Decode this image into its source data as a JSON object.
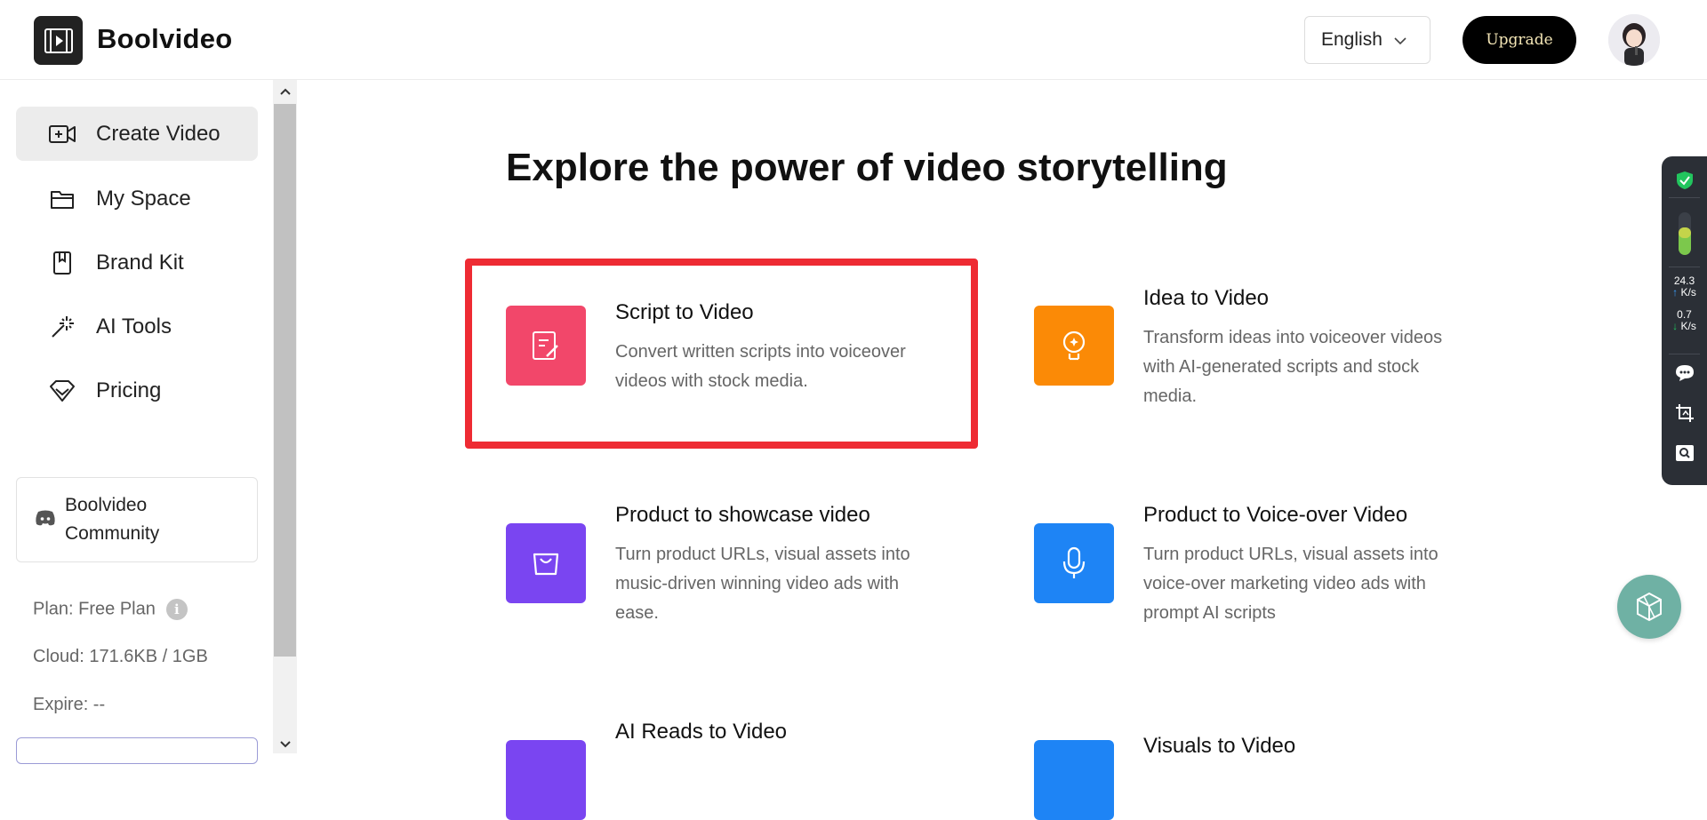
{
  "header": {
    "brand": "Boolvideo",
    "language": "English",
    "upgrade_label": "Upgrade"
  },
  "sidebar": {
    "items": [
      {
        "label": "Create Video",
        "icon": "video-plus-icon",
        "active": true
      },
      {
        "label": "My Space",
        "icon": "folder-icon",
        "active": false
      },
      {
        "label": "Brand Kit",
        "icon": "bookmark-icon",
        "active": false
      },
      {
        "label": "AI Tools",
        "icon": "magic-wand-icon",
        "active": false
      },
      {
        "label": "Pricing",
        "icon": "diamond-icon",
        "active": false
      }
    ],
    "community": {
      "line1": "Boolvideo",
      "line2": "Community"
    },
    "plan": "Plan: Free Plan",
    "cloud": "Cloud: 171.6KB / 1GB",
    "expire": "Expire: --"
  },
  "main": {
    "title": "Explore the power of video storytelling",
    "cards": [
      {
        "title": "Script to Video",
        "desc1": "Convert written scripts into voiceover",
        "desc2": "videos with stock media.",
        "color": "#f2476a",
        "icon": "script-edit-icon"
      },
      {
        "title": "Idea to Video",
        "desc1": "Transform ideas into voiceover videos",
        "desc2": "with AI-generated scripts and stock",
        "desc3": "media.",
        "color": "#fb8a06",
        "icon": "lightbulb-icon"
      },
      {
        "title": "Product to showcase video",
        "desc1": "Turn product URLs, visual assets into",
        "desc2": "music-driven winning video ads with",
        "desc3": "ease.",
        "color": "#7a45f1",
        "icon": "shopping-bag-icon"
      },
      {
        "title": "Product to Voice-over Video",
        "desc1": "Turn product URLs, visual assets into",
        "desc2": "voice-over marketing video ads with",
        "desc3": "prompt AI scripts",
        "color": "#1e84f5",
        "icon": "microphone-icon"
      },
      {
        "title": "AI Reads to Video",
        "color": "#7a45f1"
      },
      {
        "title": "Visuals to Video",
        "color": "#1e84f5"
      }
    ]
  },
  "toolbar": {
    "upload_speed": "24.3",
    "upload_unit": "K/s",
    "download_speed": "0.7",
    "download_unit": "K/s"
  }
}
